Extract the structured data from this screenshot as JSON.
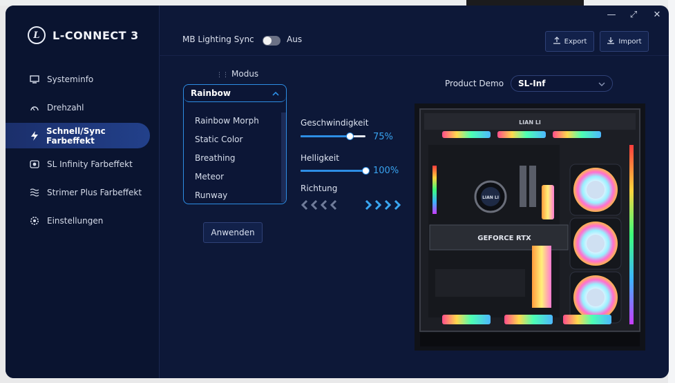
{
  "app": {
    "name": "L-CONNECT 3"
  },
  "sidebar": {
    "items": [
      {
        "label": "Systeminfo",
        "icon": "monitor-icon"
      },
      {
        "label": "Drehzahl",
        "icon": "gauge-icon"
      },
      {
        "label": "Schnell/Sync Farbeffekt",
        "icon": "lightning-icon",
        "active": true
      },
      {
        "label": "SL Infinity Farbeffekt",
        "icon": "fan-icon"
      },
      {
        "label": "Strimer Plus Farbeffekt",
        "icon": "waves-icon"
      },
      {
        "label": "Einstellungen",
        "icon": "gear-icon"
      }
    ]
  },
  "toolbar": {
    "sync_label": "MB Lighting Sync",
    "sync_state": "Aus",
    "export_label": "Export",
    "import_label": "Import"
  },
  "modus": {
    "label": "Modus",
    "selected": "Rainbow",
    "options": [
      "Rainbow Morph",
      "Static Color",
      "Breathing",
      "Meteor",
      "Runway"
    ],
    "apply_label": "Anwenden"
  },
  "controls": {
    "speed_label": "Geschwindigkeit",
    "speed_value": "75%",
    "speed_fraction": 0.75,
    "brightness_label": "Helligkeit",
    "brightness_value": "100%",
    "brightness_fraction": 1.0,
    "direction_label": "Richtung"
  },
  "product": {
    "label": "Product Demo",
    "selected": "SL-Inf"
  },
  "case_text": {
    "brand": "LIAN LI",
    "gpu": "GEFORCE RTX",
    "cooler": "LIAN LI"
  },
  "colors": {
    "accent": "#2d8ee5",
    "app_bg": "#0d1838",
    "sidebar_bg": "#0a1430"
  }
}
